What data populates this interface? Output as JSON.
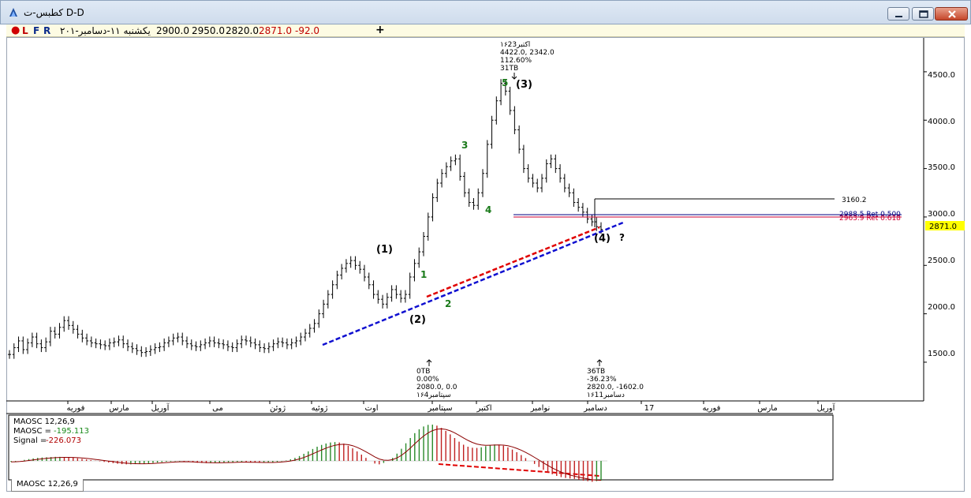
{
  "window": {
    "title": "کطبس-ت D-D",
    "buttons": [
      "minimize-button",
      "restore-button",
      "close-button"
    ]
  },
  "toolbar": {
    "dot_color": "#d00000",
    "btn_L": "L",
    "btn_F": "F",
    "btn_R": "R",
    "date": "یکشنبه ۱۱-دسامبر-۲۰۱",
    "open": "2900.0",
    "high": "2950.0",
    "low": "2820.0",
    "close": "2871.0",
    "change": "-92.0",
    "add": "+"
  },
  "chart_data": [
    {
      "type": "bar",
      "subtype": "ohlc",
      "ylim": [
        1100,
        4850
      ],
      "y_ticks": [
        "4500.0",
        "4000.0",
        "3500.0",
        "3000.0",
        "2500.0",
        "2000.0",
        "1500.0"
      ],
      "x_ticks": [
        "فوریه",
        "مارس",
        "آوریل",
        "می",
        "ژوئن",
        "ژوئیه",
        "اوت",
        "سپتامبر",
        "اکتبر",
        "نوامبر",
        "دسامبر",
        "17",
        "فوریه",
        "مارس",
        "آوریل"
      ],
      "grid": false,
      "last_price": "2871.0",
      "level_label": "3160.2",
      "fib_labels": [
        "2988.5 Ret 0.500",
        "2963.9 Ret 0.618"
      ],
      "wave_labels_primary": [
        "(1)",
        "(2)",
        "(3)",
        "(4)",
        "?"
      ],
      "wave_labels_minor": [
        "1",
        "2",
        "3",
        "4",
        "5"
      ],
      "peak_annotation": [
        "۱۶اکتبر23",
        "4422.0, 2342.0",
        "112.60%",
        "31TB"
      ],
      "trough_annotation_left": [
        "0TB",
        "0.00%",
        "2080.0, 0.0",
        "۱۶سپتامبر4"
      ],
      "trough_annotation_right": [
        "36TB",
        "-36.23%",
        "2820.0, -1602.0",
        "۱۶دسامبر11"
      ],
      "colors": {
        "bars": "#000000",
        "red_trend": "#e00000",
        "blue_trend": "#1010d0",
        "minor_waves": "#1a7a1a",
        "last_price_bg": "#ffff00",
        "fib_red": "#cc0033",
        "fib_blue": "#000080"
      },
      "series": [
        {
          "values": [
            1580,
            1650,
            1720,
            1630,
            1700,
            1760,
            1690,
            1650,
            1710,
            1820,
            1790,
            1860,
            1930,
            1880,
            1840,
            1790,
            1750,
            1720,
            1700,
            1690,
            1680,
            1670,
            1700,
            1710,
            1730,
            1690,
            1660,
            1640,
            1620,
            1600,
            1610,
            1630,
            1650,
            1660,
            1700,
            1720,
            1750,
            1760,
            1720,
            1690,
            1670,
            1660,
            1680,
            1700,
            1720,
            1700,
            1690,
            1680,
            1660,
            1650,
            1690,
            1730,
            1720,
            1700,
            1680,
            1650,
            1640,
            1660,
            1690,
            1710,
            1700,
            1680,
            1700,
            1720,
            1760,
            1800,
            1850,
            1900,
            2000,
            2100,
            2200,
            2300,
            2400,
            2470,
            2520,
            2550,
            2500,
            2460,
            2380,
            2300,
            2200,
            2150,
            2100,
            2170,
            2250,
            2200,
            2160,
            2200,
            2380,
            2520,
            2640,
            2800,
            3000,
            3200,
            3350,
            3450,
            3520,
            3580,
            3600,
            3420,
            3250,
            3150,
            3120,
            3250,
            3450,
            3750,
            4000,
            4200,
            4380,
            4300,
            4100,
            3900,
            3700,
            3500,
            3400,
            3350,
            3300,
            3400,
            3550,
            3600,
            3500,
            3400,
            3300,
            3250,
            3150,
            3100,
            3050,
            2980,
            2950,
            2900,
            2871
          ]
        }
      ]
    },
    {
      "type": "bar",
      "subtype": "macd-histogram",
      "tab_label": "MAOSC 12,26,9",
      "legend": [
        {
          "label": "MAOSC 12,26,9",
          "color": "#000000"
        },
        {
          "label": "MAOSC = ",
          "value": "-195.113",
          "value_color": "#1a8a1a"
        },
        {
          "label": "Signal = ",
          "value": "-226.073",
          "value_color": "#b00000"
        }
      ],
      "colors": {
        "positive": "#2a8a2a",
        "negative": "#c02020",
        "signal": "#8b0000",
        "divergence": "#e00000"
      },
      "series": [
        {
          "name": "MAOSC",
          "values": [
            -10,
            -5,
            0,
            10,
            18,
            25,
            30,
            34,
            36,
            38,
            40,
            40,
            38,
            36,
            32,
            26,
            20,
            14,
            8,
            2,
            -4,
            -10,
            -16,
            -22,
            -28,
            -32,
            -34,
            -34,
            -32,
            -30,
            -28,
            -24,
            -20,
            -16,
            -12,
            -8,
            -6,
            -4,
            -4,
            -6,
            -10,
            -14,
            -18,
            -20,
            -22,
            -22,
            -20,
            -18,
            -16,
            -14,
            -12,
            -10,
            -10,
            -12,
            -14,
            -16,
            -18,
            -18,
            -16,
            -14,
            -10,
            -4,
            4,
            16,
            30,
            48,
            70,
            94,
            118,
            140,
            158,
            172,
            182,
            186,
            182,
            170,
            150,
            124,
            94,
            62,
            30,
            0,
            -26,
            -34,
            -20,
            0,
            30,
            72,
            120,
            174,
            226,
            274,
            312,
            340,
            356,
            358,
            348,
            326,
            296,
            262,
            226,
            190,
            160,
            140,
            130,
            128,
            134,
            146,
            156,
            162,
            160,
            150,
            134,
            112,
            86,
            58,
            28,
            0,
            -30,
            -60,
            -88,
            -112,
            -132,
            -148,
            -160,
            -168,
            -174,
            -178,
            -186,
            -195,
            -200,
            -206,
            -200,
            -195
          ]
        }
      ]
    }
  ]
}
